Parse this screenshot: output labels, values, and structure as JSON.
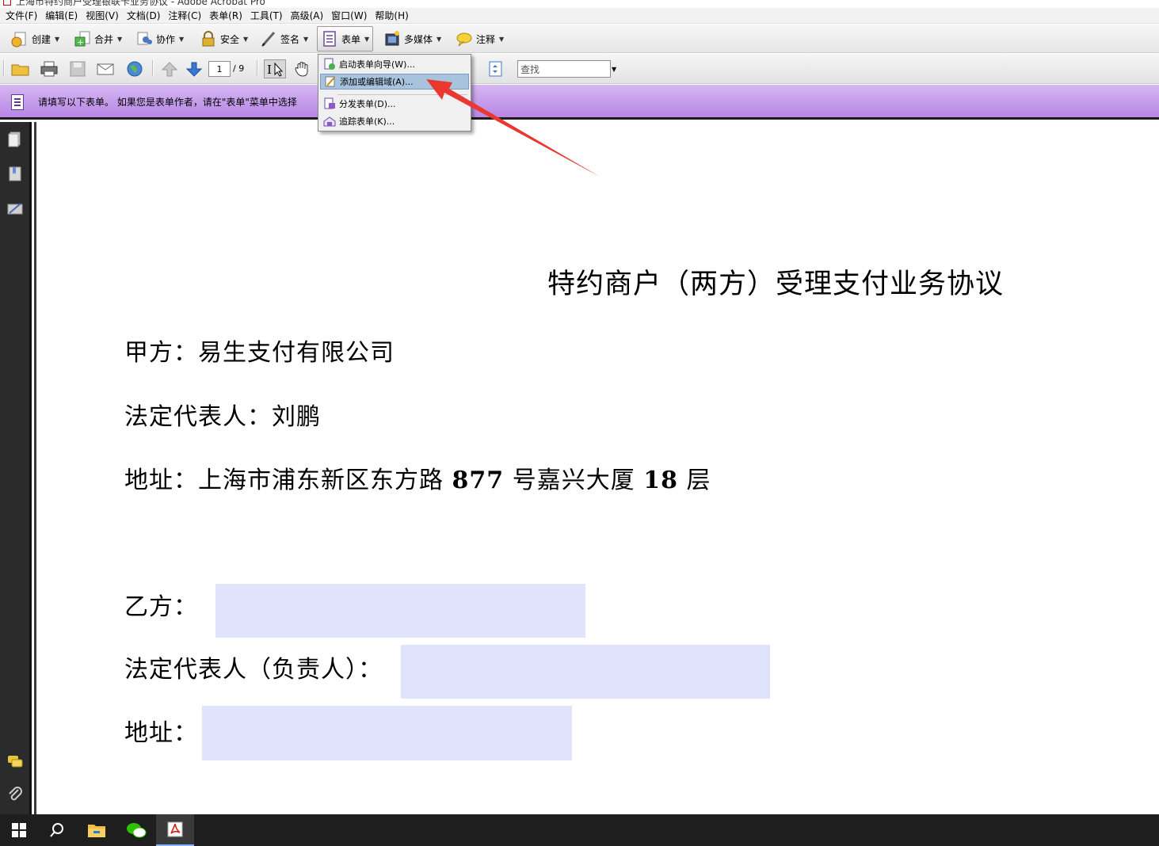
{
  "window": {
    "title": "上海市特约商户受理银联卡业务协议 - Adobe Acrobat Pro"
  },
  "menubar": {
    "items": [
      "文件(F)",
      "编辑(E)",
      "视图(V)",
      "文档(D)",
      "注释(C)",
      "表单(R)",
      "工具(T)",
      "高级(A)",
      "窗口(W)",
      "帮助(H)"
    ]
  },
  "toolbar": {
    "create": "创建",
    "combine": "合并",
    "collaborate": "协作",
    "secure": "安全",
    "sign": "签名",
    "forms": "表单",
    "multimedia": "多媒体",
    "comment": "注释"
  },
  "navigation": {
    "current_page": "1",
    "total_pages": "/ 9",
    "search_placeholder": "查找"
  },
  "form_bar": {
    "message": "请填写以下表单。 如果您是表单作者，请在\"表单\"菜单中选择"
  },
  "forms_menu": {
    "items": [
      {
        "label": "启动表单向导(W)...",
        "highlighted": false
      },
      {
        "label": "添加或编辑域(A)...",
        "highlighted": true
      },
      {
        "label": "分发表单(D)...",
        "highlighted": false
      },
      {
        "label": "追踪表单(K)...",
        "highlighted": false
      }
    ]
  },
  "document": {
    "title": "特约商户（两方）受理支付业务协议",
    "party_a": "甲方：易生支付有限公司",
    "party_a_rep": "法定代表人：刘鹏",
    "party_a_address_prefix": "地址：上海市浦东新区东方路 ",
    "party_a_address_num1": "877",
    "party_a_address_mid": " 号嘉兴大厦 ",
    "party_a_address_num2": "18",
    "party_a_address_suffix": " 层",
    "party_b_label": "乙方：",
    "party_b_rep_label": "法定代表人（负责人）：",
    "party_b_address_label": "地址：",
    "party_b_value": "",
    "party_b_rep_value": "",
    "party_b_address_value": ""
  },
  "colors": {
    "form_bar": "#c8a2ee",
    "form_field": "#dfe3fb",
    "arrow": "#e8382f",
    "menu_highlight": "#a8c3dd"
  },
  "icons": {
    "taskbar": [
      "windows-start-icon",
      "search-icon",
      "file-explorer-icon",
      "wechat-icon",
      "acrobat-icon"
    ]
  }
}
